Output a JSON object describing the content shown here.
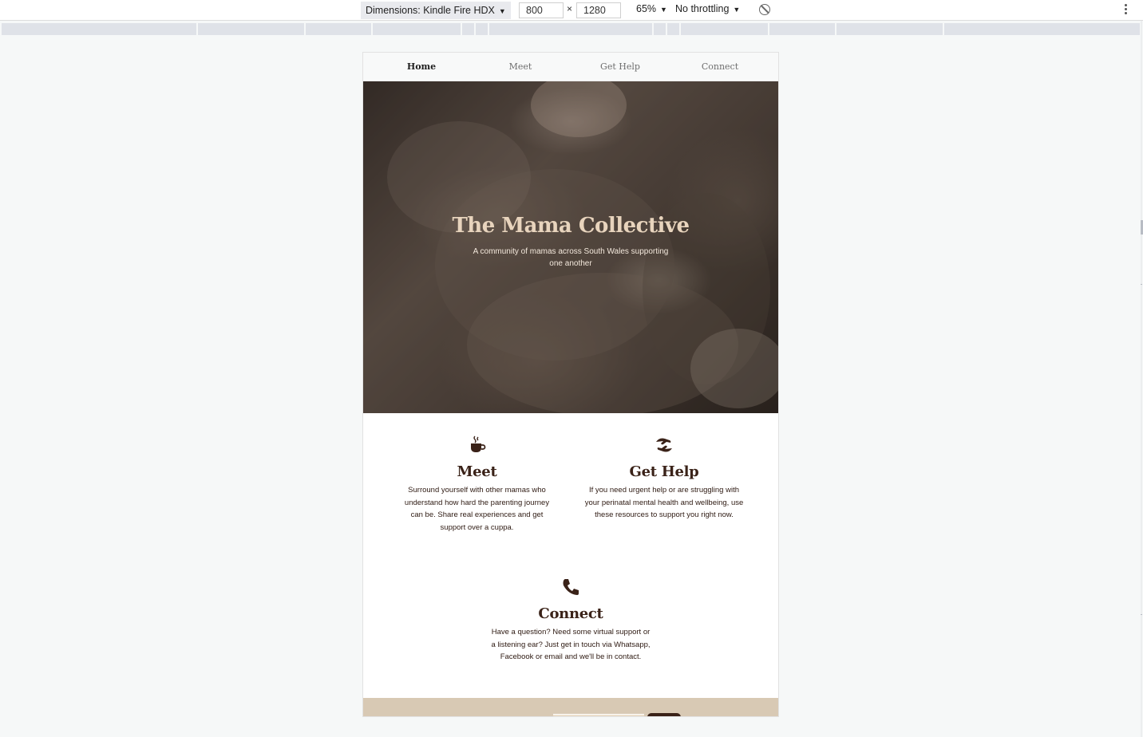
{
  "devtools": {
    "device_label": "Dimensions: Kindle Fire HDX",
    "width_value": "800",
    "height_value": "1280",
    "times": "×",
    "zoom_label": "65%",
    "throttle_label": "No throttling"
  },
  "nav": {
    "items": [
      {
        "label": "Home",
        "active": true
      },
      {
        "label": "Meet",
        "active": false
      },
      {
        "label": "Get Help",
        "active": false
      },
      {
        "label": "Connect",
        "active": false
      }
    ]
  },
  "hero": {
    "title": "The Mama Collective",
    "subtitle": "A community of mamas across South Wales supporting one another"
  },
  "features": [
    {
      "icon": "coffee-cup-icon",
      "title": "Meet",
      "text": "Surround yourself with other mamas who understand how hard the parenting journey can be. Share real experiences and get support over a cuppa."
    },
    {
      "icon": "helping-hands-icon",
      "title": "Get Help",
      "text": "If you need urgent help or are struggling with your perinatal mental health and wellbeing, use these resources to support you right now."
    },
    {
      "icon": "phone-icon",
      "title": "Connect",
      "text": "Have a question? Need some virtual support or a listening ear? Just get in touch via Whatsapp, Facebook or email and we'll be in contact."
    }
  ],
  "colors": {
    "brand_dark": "#3a2218",
    "hero_title": "#e8d4bd",
    "footer_band": "#d8c9b4"
  }
}
